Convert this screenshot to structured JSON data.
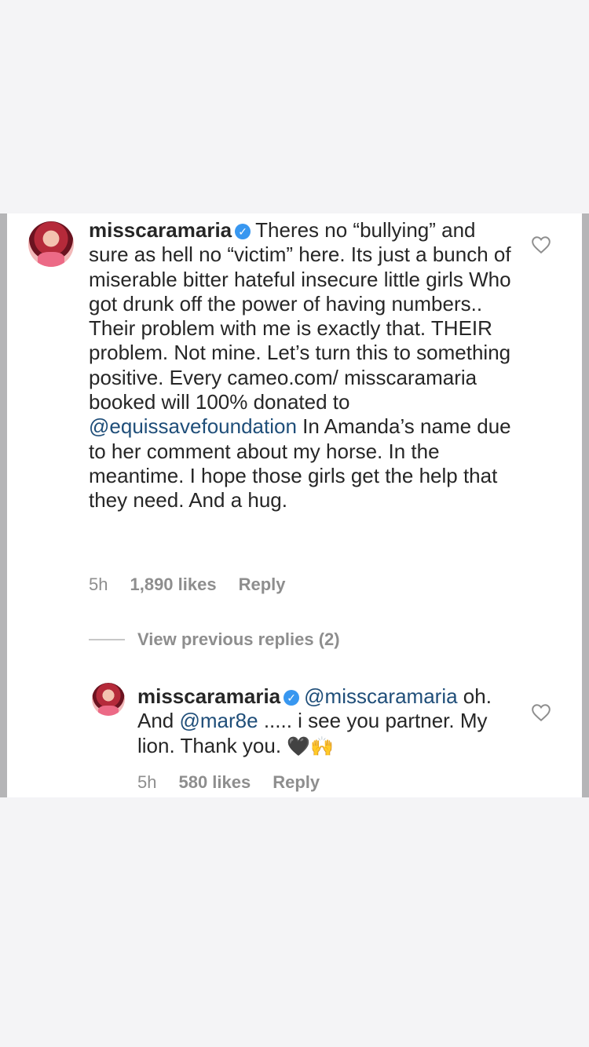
{
  "comment": {
    "username": "misscaramaria",
    "text_before_mention": "Theres no “bullying” and sure as hell no “victim” here. Its just a bunch of miserable bitter hateful insecure little girls Who got drunk off the power of having numbers.. Their problem with me is exactly that. THEIR problem. Not mine. Let’s turn this to something positive. Every cameo.com/ misscaramaria booked will 100% donated to",
    "mention": "@equissavefoundation",
    "text_after_mention": "In Amanda’s name due to her comment about my horse. In the meantime. I hope those girls get the help that they need. And a hug.",
    "time": "5h",
    "likes": "1,890 likes",
    "reply_label": "Reply"
  },
  "view_previous_replies": "View previous replies (2)",
  "reply": {
    "username": "misscaramaria",
    "mention_1": "@misscaramaria",
    "text_1": "oh. And",
    "mention_2": "@mar8e",
    "text_2": "..... i see you partner.  My lion. Thank you.",
    "emoji_heart": "🖤",
    "emoji_hands": "🙌",
    "time": "5h",
    "likes": "580 likes",
    "reply_label": "Reply"
  },
  "colors": {
    "verified": "#3897f0",
    "mention": "#1f4e79",
    "meta": "#8e8e8e"
  }
}
